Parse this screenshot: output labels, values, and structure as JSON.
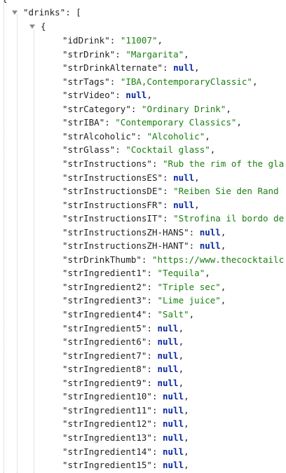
{
  "punct": {
    "colon": ": ",
    "comma": ",",
    "open_brace": "{",
    "open_bracket": "[",
    "quote": "\""
  },
  "colors": {
    "key": "#1f1f1f",
    "string": "#1a7f11",
    "null": "#0b2a9e",
    "guide": "#c8c8c8",
    "arrow": "#8c8c8c"
  },
  "root_key": "drinks",
  "fields": [
    {
      "key": "idDrink",
      "value": "\"11007\"",
      "type": "string"
    },
    {
      "key": "strDrink",
      "value": "\"Margarita\"",
      "type": "string"
    },
    {
      "key": "strDrinkAlternate",
      "value": "null",
      "type": "null"
    },
    {
      "key": "strTags",
      "value": "\"IBA,ContemporaryClassic\"",
      "type": "string"
    },
    {
      "key": "strVideo",
      "value": "null",
      "type": "null"
    },
    {
      "key": "strCategory",
      "value": "\"Ordinary Drink\"",
      "type": "string"
    },
    {
      "key": "strIBA",
      "value": "\"Contemporary Classics\"",
      "type": "string"
    },
    {
      "key": "strAlcoholic",
      "value": "\"Alcoholic\"",
      "type": "string"
    },
    {
      "key": "strGlass",
      "value": "\"Cocktail glass\"",
      "type": "string"
    },
    {
      "key": "strInstructions",
      "value": "\"Rub the rim of the gla",
      "type": "string"
    },
    {
      "key": "strInstructionsES",
      "value": "null",
      "type": "null"
    },
    {
      "key": "strInstructionsDE",
      "value": "\"Reiben Sie den Rand",
      "type": "string"
    },
    {
      "key": "strInstructionsFR",
      "value": "null",
      "type": "null"
    },
    {
      "key": "strInstructionsIT",
      "value": "\"Strofina il bordo de",
      "type": "string"
    },
    {
      "key": "strInstructionsZH-HANS",
      "value": "null",
      "type": "null"
    },
    {
      "key": "strInstructionsZH-HANT",
      "value": "null",
      "type": "null"
    },
    {
      "key": "strDrinkThumb",
      "value": "\"https://www.thecocktailc",
      "type": "string"
    },
    {
      "key": "strIngredient1",
      "value": "\"Tequila\"",
      "type": "string"
    },
    {
      "key": "strIngredient2",
      "value": "\"Triple sec\"",
      "type": "string"
    },
    {
      "key": "strIngredient3",
      "value": "\"Lime juice\"",
      "type": "string"
    },
    {
      "key": "strIngredient4",
      "value": "\"Salt\"",
      "type": "string"
    },
    {
      "key": "strIngredient5",
      "value": "null",
      "type": "null"
    },
    {
      "key": "strIngredient6",
      "value": "null",
      "type": "null"
    },
    {
      "key": "strIngredient7",
      "value": "null",
      "type": "null"
    },
    {
      "key": "strIngredient8",
      "value": "null",
      "type": "null"
    },
    {
      "key": "strIngredient9",
      "value": "null",
      "type": "null"
    },
    {
      "key": "strIngredient10",
      "value": "null",
      "type": "null"
    },
    {
      "key": "strIngredient11",
      "value": "null",
      "type": "null"
    },
    {
      "key": "strIngredient12",
      "value": "null",
      "type": "null"
    },
    {
      "key": "strIngredient13",
      "value": "null",
      "type": "null"
    },
    {
      "key": "strIngredient14",
      "value": "null",
      "type": "null"
    },
    {
      "key": "strIngredient15",
      "value": "null",
      "type": "null"
    }
  ]
}
